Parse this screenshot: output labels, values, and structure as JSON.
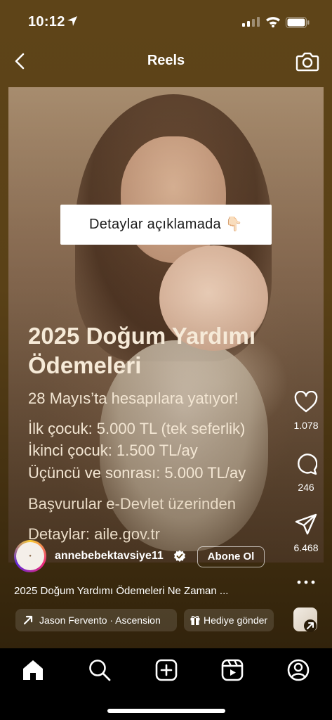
{
  "status_bar": {
    "time": "10:12"
  },
  "header": {
    "title": "Reels"
  },
  "video": {
    "overlay_pill": "Detaylar açıklamada 👇🏻",
    "headline": "2025 Doğum Yardımı Ödemeleri",
    "line1": "28 Mayıs’ta hesapılara yatıyor!",
    "line2": "İlk çocuk: 5.000 TL (tek seferlik)",
    "line3": "İkinci çocuk: 1.500 TL/ay",
    "line4": "Üçüncü ve sonrası: 5.000 TL/ay",
    "line5": "Başvurular e-Devlet üzerinden",
    "line6": "Detaylar: aile.gov.tr"
  },
  "actions": {
    "likes": "1.078",
    "comments": "246",
    "shares": "6.468"
  },
  "author": {
    "username": "annebebektavsiye11",
    "follow_label": "Abone Ol"
  },
  "caption": "2025 Doğum Yardımı Ödemeleri Ne Zaman ...",
  "chips": {
    "audio": "Jason Fervento · Ascension",
    "gift": "Hediye gönder"
  },
  "icons": [
    "back-icon",
    "camera-icon",
    "heart-icon",
    "comment-icon",
    "share-icon",
    "more-icon",
    "home-icon",
    "search-icon",
    "create-icon",
    "reels-icon",
    "profile-icon"
  ]
}
